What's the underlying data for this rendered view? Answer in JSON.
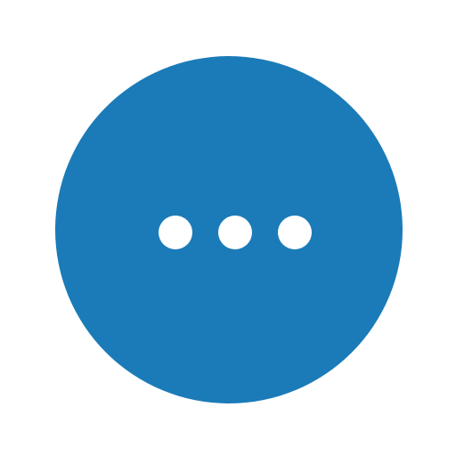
{
  "button": {
    "icon": "more-horizontal-icon",
    "color": "#1b7bb8",
    "dot_color": "#ffffff"
  }
}
